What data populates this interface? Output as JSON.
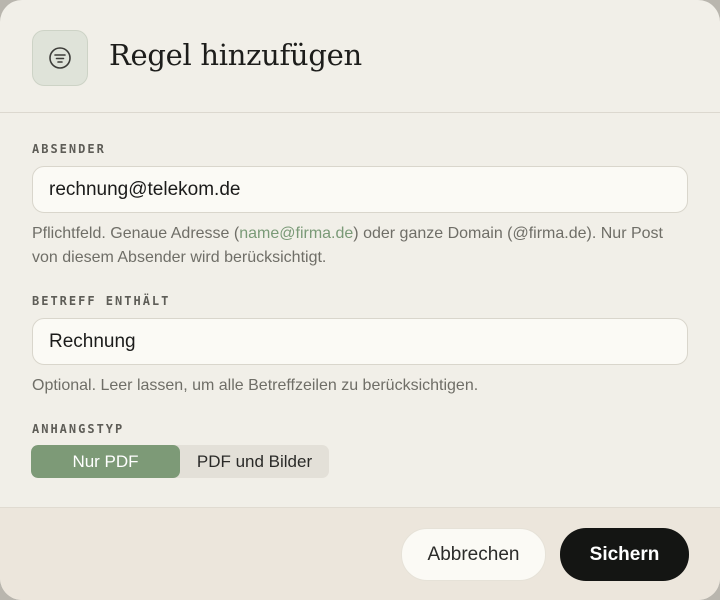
{
  "dialog": {
    "title": "Regel hinzufügen",
    "icon": "filter-icon"
  },
  "sender": {
    "label": "ABSENDER",
    "value": "rechnung@telekom.de",
    "hint_before": "Pflichtfeld. Genaue Adresse (",
    "hint_example": "name@firma.de",
    "hint_after": ") oder ganze Domain (@firma.de). Nur Post von diesem Absender wird berücksichtigt."
  },
  "subject": {
    "label": "BETREFF ENTHÄLT",
    "value": "Rechnung",
    "hint": "Optional. Leer lassen, um alle Betreffzeilen zu berücksichtigen."
  },
  "attachment": {
    "label": "ANHANGSTYP",
    "options": [
      "Nur PDF",
      "PDF und Bilder"
    ],
    "selected": "Nur PDF"
  },
  "footer": {
    "cancel_label": "Abbrechen",
    "save_label": "Sichern"
  },
  "colors": {
    "accent": "#7d9a77",
    "primary_button": "#141513",
    "background": "#f1efe8"
  }
}
